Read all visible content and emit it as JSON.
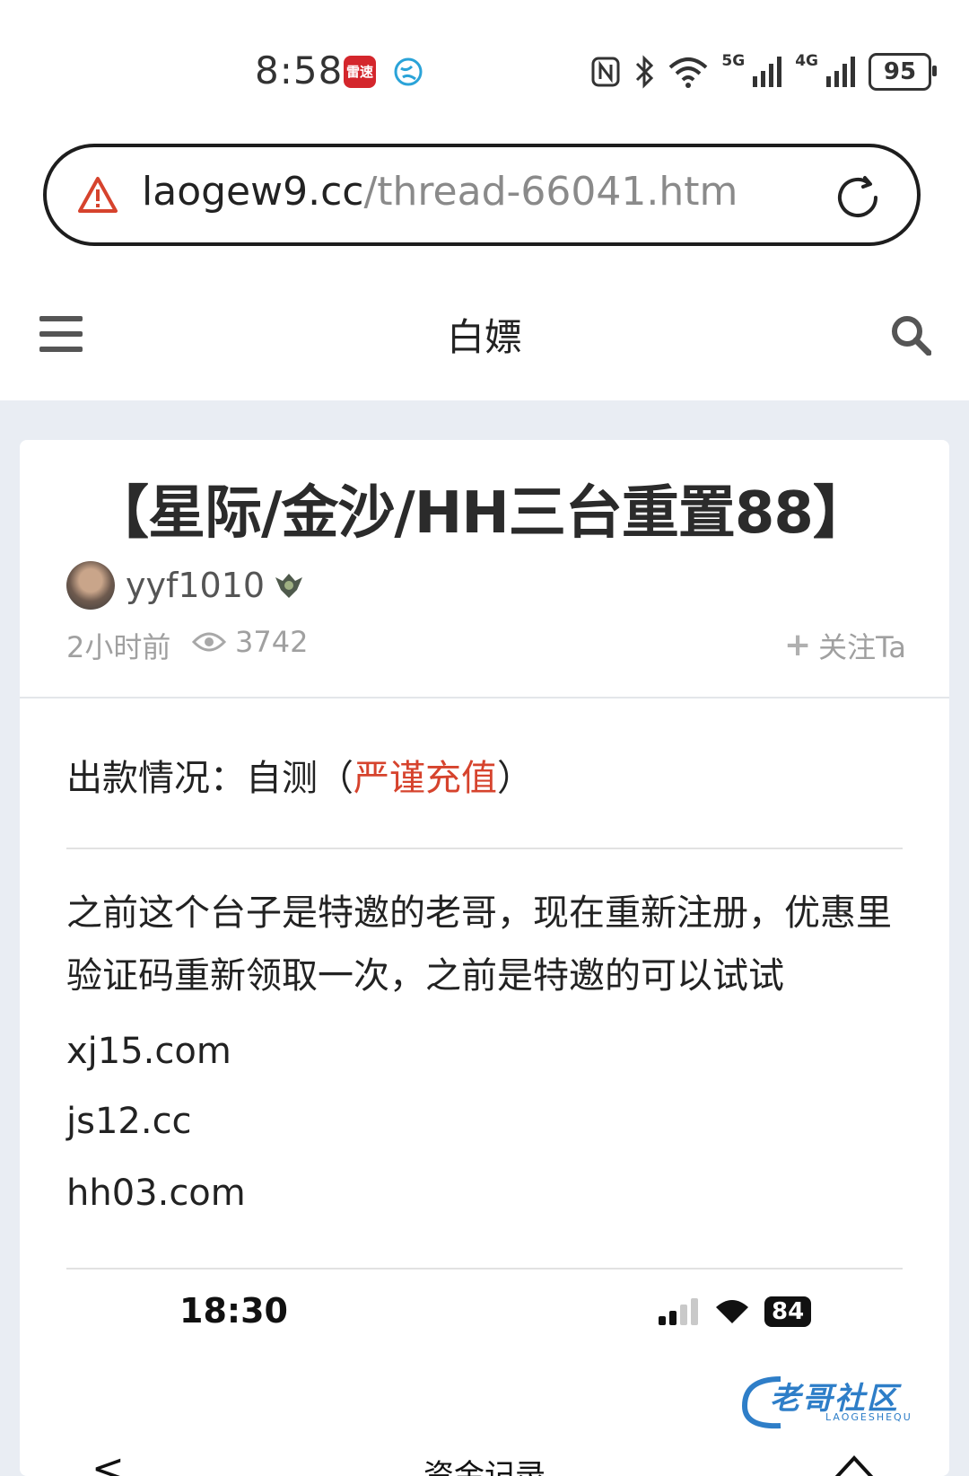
{
  "status_bar": {
    "time": "8:58",
    "app1_label": "雷速",
    "network_5g": "5G",
    "network_4g": "4G",
    "battery": "95",
    "icons": [
      "nfc-icon",
      "bluetooth-icon",
      "wifi-icon",
      "signal-5g-icon",
      "signal-4g-icon",
      "battery-icon"
    ]
  },
  "url_bar": {
    "host": "laogew9.cc",
    "path": "/thread-66041.htm",
    "warning_color": "#d6432d"
  },
  "site_header": {
    "title": "白嫖"
  },
  "thread": {
    "title": "【星际/金沙/HH三台重置88】",
    "author": "yyf1010",
    "posted": "2小时前",
    "views": "3742",
    "follow_label": "关注Ta"
  },
  "content": {
    "status_prefix": "出款情况：自测（",
    "status_note": "严谨充值",
    "status_suffix": "）",
    "paragraph": "之前这个台子是特邀的老哥，现在重新注册，优惠里验证码重新领取一次，之前是特邀的可以试试",
    "links": [
      "xj15.com",
      "js12.cc",
      "hh03.com"
    ],
    "accent_color": "#d6432d"
  },
  "embedded_screenshot": {
    "time": "18:30",
    "battery": "84",
    "page_title": "资金记录",
    "back_label": "<"
  },
  "watermark": {
    "text": "老哥社区",
    "sub": "LAOGESHEQU"
  }
}
